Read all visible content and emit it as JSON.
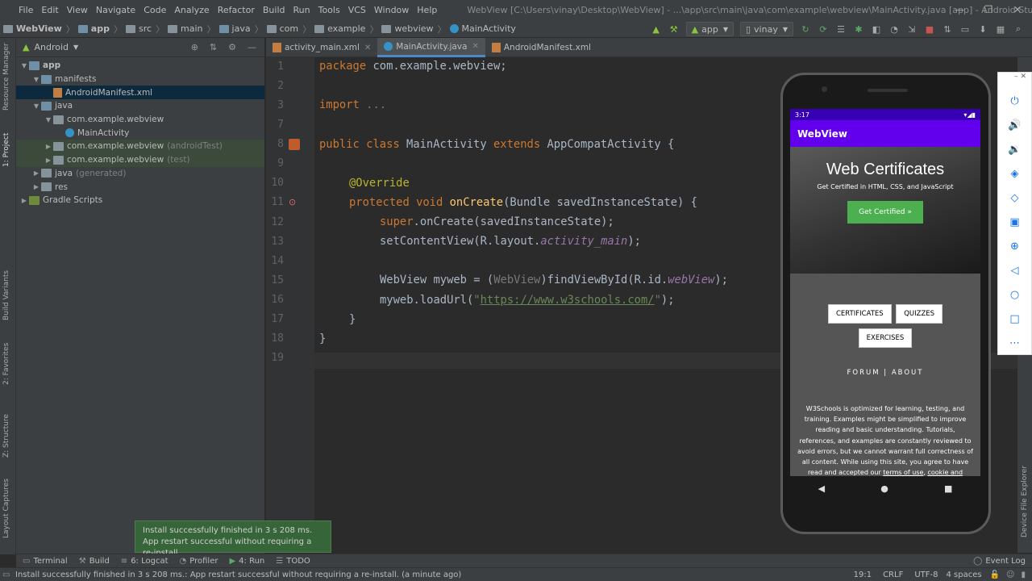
{
  "menu": {
    "items": [
      "File",
      "Edit",
      "View",
      "Navigate",
      "Code",
      "Analyze",
      "Refactor",
      "Build",
      "Run",
      "Tools",
      "VCS",
      "Window",
      "Help"
    ],
    "title": "WebView [C:\\Users\\vinay\\Desktop\\WebView] - ...\\app\\src\\main\\java\\com\\example\\webview\\MainActivity.java [app] - Android Studio"
  },
  "breadcrumb": [
    "WebView",
    "app",
    "src",
    "main",
    "java",
    "com",
    "example",
    "webview",
    "MainActivity"
  ],
  "toolbar": {
    "config": "app",
    "device": "vinay"
  },
  "left_strip": [
    "Resource Manager",
    "1: Project",
    "Build Variants",
    "2: Favorites",
    "Z: Structure",
    "Layout Captures"
  ],
  "project": {
    "view": "Android",
    "tree": [
      {
        "label": "app",
        "extra": "",
        "depth": 0,
        "icon": "folder-blue",
        "arrow": "▼",
        "cls": ""
      },
      {
        "label": "manifests",
        "extra": "",
        "depth": 1,
        "icon": "folder-blue",
        "arrow": "▼",
        "cls": ""
      },
      {
        "label": "AndroidManifest.xml",
        "extra": "",
        "depth": 2,
        "icon": "xml",
        "arrow": "",
        "cls": "sel"
      },
      {
        "label": "java",
        "extra": "",
        "depth": 1,
        "icon": "folder-blue",
        "arrow": "▼",
        "cls": ""
      },
      {
        "label": "com.example.webview",
        "extra": "",
        "depth": 2,
        "icon": "folder",
        "arrow": "▼",
        "cls": ""
      },
      {
        "label": "MainActivity",
        "extra": "",
        "depth": 3,
        "icon": "class",
        "arrow": "",
        "cls": ""
      },
      {
        "label": "com.example.webview",
        "extra": "(androidTest)",
        "depth": 2,
        "icon": "folder",
        "arrow": "▶",
        "cls": "hl"
      },
      {
        "label": "com.example.webview",
        "extra": "(test)",
        "depth": 2,
        "icon": "folder",
        "arrow": "▶",
        "cls": "hl"
      },
      {
        "label": "java",
        "extra": "(generated)",
        "depth": 1,
        "icon": "folder",
        "arrow": "▶",
        "cls": ""
      },
      {
        "label": "res",
        "extra": "",
        "depth": 1,
        "icon": "folder",
        "arrow": "▶",
        "cls": ""
      },
      {
        "label": "Gradle Scripts",
        "extra": "",
        "depth": 0,
        "icon": "gradle",
        "arrow": "▶",
        "cls": ""
      }
    ]
  },
  "tabs": [
    {
      "label": "activity_main.xml",
      "active": false
    },
    {
      "label": "MainActivity.java",
      "active": true
    },
    {
      "label": "AndroidManifest.xml",
      "active": false
    }
  ],
  "line_numbers": [
    "1",
    "2",
    "3",
    "7",
    "8",
    "9",
    "10",
    "11",
    "12",
    "13",
    "14",
    "15",
    "16",
    "17",
    "18",
    "19"
  ],
  "code": {
    "l1_kw": "package",
    "l1_rest": " com.example.webview;",
    "l3_kw": "import",
    "l3_fold": " ...",
    "l8_kw1": "public class",
    "l8_name": " MainActivity ",
    "l8_kw2": "extends",
    "l8_rest": " AppCompatActivity {",
    "l10": "@Override",
    "l11_kw": "protected void",
    "l11_fn": " onCreate",
    "l11_rest": "(Bundle savedInstanceState) {",
    "l12_kw": "super",
    "l12_rest": ".onCreate(savedInstanceState);",
    "l13_a": "setContentView(R.layout.",
    "l13_it": "activity_main",
    "l13_b": ");",
    "l15_a": "WebView myweb = (",
    "l15_dim": "WebView",
    "l15_b": ")findViewById(R.id.",
    "l15_it": "webView",
    "l15_c": ");",
    "l16_a": "myweb.loadUrl(",
    "l16_q1": "\"",
    "l16_url": "https://www.w3schools.com/",
    "l16_q2": "\"",
    "l16_b": ");",
    "l17": "}",
    "l18": "}"
  },
  "toast": {
    "line1": "Install successfully finished in 3 s 208 ms.",
    "line2": "App restart successful without requiring a re-install."
  },
  "tool_windows": [
    "Terminal",
    "Build",
    "6: Logcat",
    "Profiler",
    "4: Run",
    "TODO"
  ],
  "event_log": "Event Log",
  "status": {
    "message": "Install successfully finished in 3 s 208 ms.: App restart successful without requiring a re-install. (a minute ago)",
    "pos": "19:1",
    "crlf": "CRLF",
    "enc": "UTF-8",
    "indent": "4 spaces"
  },
  "right_strip": [
    "Device File Explorer"
  ],
  "phone": {
    "time": "3:17",
    "app_title": "WebView",
    "hero_title": "Web Certificates",
    "hero_sub": "Get Certified in HTML, CSS, and JavaScript",
    "cta": "Get Certified »",
    "btn1": "CERTIFICATES",
    "btn2": "QUIZZES",
    "btn3": "EXERCISES",
    "forum": "FORUM | ABOUT",
    "desc": "W3Schools is optimized for learning, testing, and training. Examples might be simplified to improve reading and basic understanding. Tutorials, references, and examples are constantly reviewed to avoid errors, but we cannot warrant full correctness of all content. While using this site, you agree to have read and accepted our ",
    "terms": "terms of use",
    "cookie": "cookie and"
  }
}
